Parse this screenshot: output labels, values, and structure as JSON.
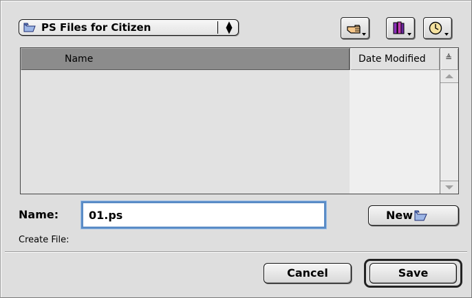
{
  "dialog": {
    "folder_popup": {
      "label": "PS Files for Citizen",
      "icon": "folder-icon"
    },
    "toolbar": [
      {
        "name": "shortcuts-button",
        "icon": "pointing-hand-icon"
      },
      {
        "name": "favorites-button",
        "icon": "books-icon"
      },
      {
        "name": "recent-button",
        "icon": "clock-icon"
      }
    ],
    "file_list": {
      "columns": [
        "Name",
        "Date Modified"
      ],
      "sort_indicator": "≜",
      "rows": []
    },
    "name_label": "Name:",
    "name_value": "01.ps",
    "new_button": "New",
    "create_label": "Create File:",
    "cancel_button": "Cancel",
    "save_button": "Save"
  },
  "colors": {
    "background": "#dedede",
    "header_active": "#8c8c8c",
    "focus_ring": "#5a8cc6"
  }
}
